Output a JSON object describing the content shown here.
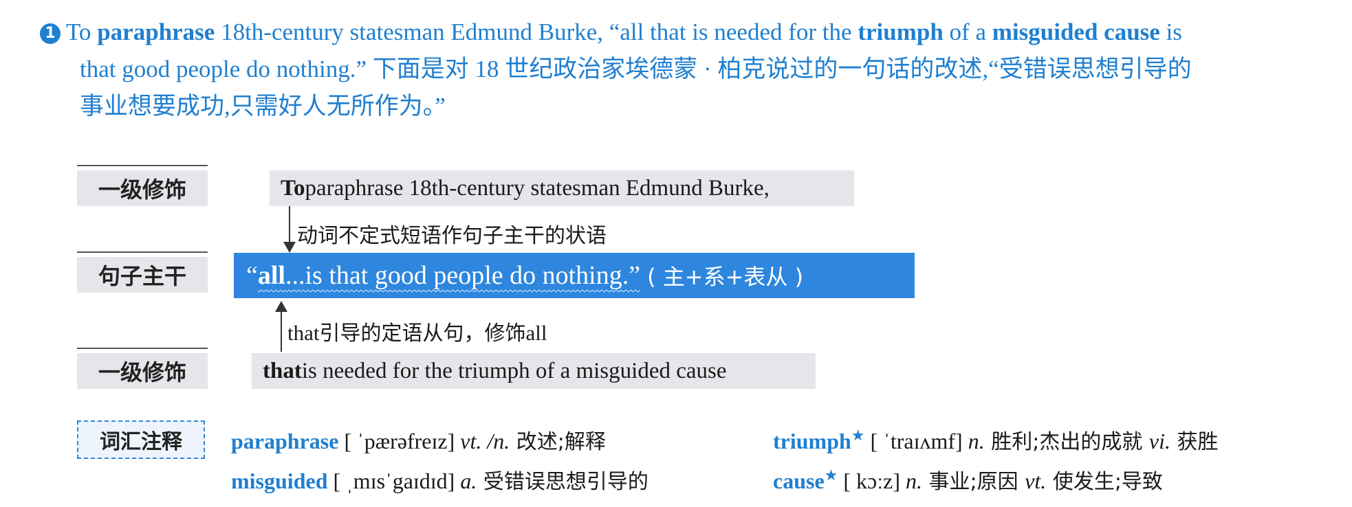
{
  "intro": {
    "number": "1",
    "l1_a": "To ",
    "l1_b": "paraphrase",
    "l1_c": " 18th-century statesman Edmund Burke, “all that is needed for the ",
    "l1_d": "triumph",
    "l1_e": " of a ",
    "l1_f": "misguided cause",
    "l1_g": " is",
    "l2": "that good people do nothing.” 下面是对 18 世纪政治家埃德蒙 · 柏克说过的一句话的改述,“受错误思想引导的",
    "l3": "事业想要成功,只需好人无所作为。”"
  },
  "diagram": {
    "tag_top": "一级修饰",
    "tag_core": "句子主干",
    "tag_bottom": "一级修饰",
    "top_bold": "To",
    "top_rest": " paraphrase 18th-century statesman Edmund Burke,",
    "top_note": "动词不定式短语作句子主干的状语",
    "core_open": "“",
    "core_all": "all",
    "core_rest": "...is that good people do nothing.”",
    "core_paren": "( 主+系+表从 )",
    "bottom_note_en": "that",
    "bottom_note_zh": "引导的定语从句，修饰",
    "bottom_note_en2": "all",
    "bottom_bold": "that",
    "bottom_rest": " is needed for the triumph of a misguided cause"
  },
  "vocab": {
    "tag": "词汇注释",
    "entries": [
      {
        "word": "paraphrase",
        "star": "",
        "ipa": " [ ˈpærəfreɪz] ",
        "pos1": "vt. /n.",
        "zh1": " 改述;解释",
        "pos2": "",
        "zh2": ""
      },
      {
        "word": "triumph",
        "star": "★",
        "ipa": " [ ˈtraɪʌmf] ",
        "pos1": "n.",
        "zh1": " 胜利;杰出的成就 ",
        "pos2": "vi.",
        "zh2": " 获胜"
      },
      {
        "word": "misguided",
        "star": "",
        "ipa": " [ ˌmɪsˈgaɪdɪd] ",
        "pos1": "a.",
        "zh1": " 受错误思想引导的",
        "pos2": "",
        "zh2": ""
      },
      {
        "word": "cause",
        "star": "★",
        "ipa": " [ kɔːz] ",
        "pos1": "n.",
        "zh1": " 事业;原因 ",
        "pos2": "vt.",
        "zh2": " 使发生;导致"
      }
    ]
  }
}
